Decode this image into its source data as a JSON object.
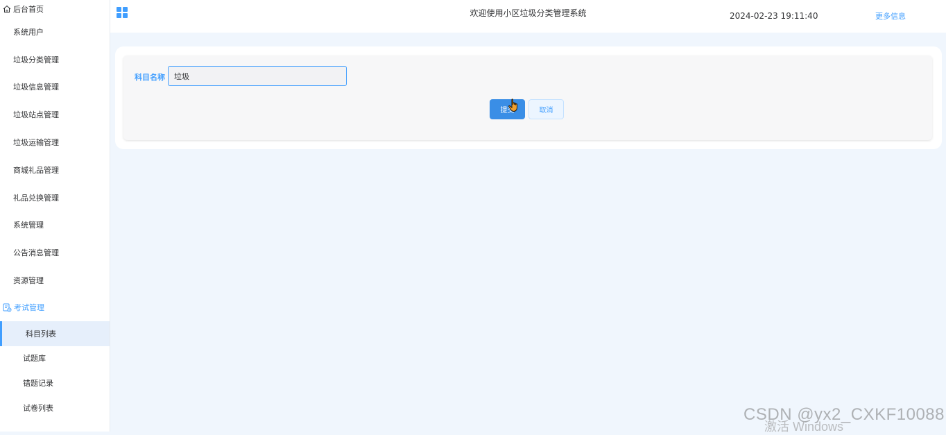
{
  "sidebar": {
    "home": "后台首页",
    "items": [
      {
        "label": "系统用户"
      },
      {
        "label": "垃圾分类管理"
      },
      {
        "label": "垃圾信息管理"
      },
      {
        "label": "垃圾站点管理"
      },
      {
        "label": "垃圾运输管理"
      },
      {
        "label": "商城礼品管理"
      },
      {
        "label": "礼品兑换管理"
      },
      {
        "label": "系统管理"
      },
      {
        "label": "公告消息管理"
      },
      {
        "label": "资源管理"
      }
    ],
    "exam": {
      "label": "考试管理",
      "submenu": [
        {
          "label": "科目列表",
          "active": true
        },
        {
          "label": "试题库"
        },
        {
          "label": "错题记录"
        },
        {
          "label": "试卷列表"
        }
      ]
    }
  },
  "header": {
    "title": "欢迎使用小区垃圾分类管理系统",
    "datetime": "2024-02-23 19:11:40",
    "more": "更多信息"
  },
  "form": {
    "subject_label": "科目名称",
    "subject_value": "垃圾",
    "submit_label": "提交",
    "cancel_label": "取消"
  },
  "watermark": {
    "csdn": "CSDN @yx2_CXKF10088",
    "windows": "激活 Windows"
  },
  "colors": {
    "accent": "#409eff",
    "background": "#f0f6fd",
    "active_menu_bg": "#e6effb"
  }
}
